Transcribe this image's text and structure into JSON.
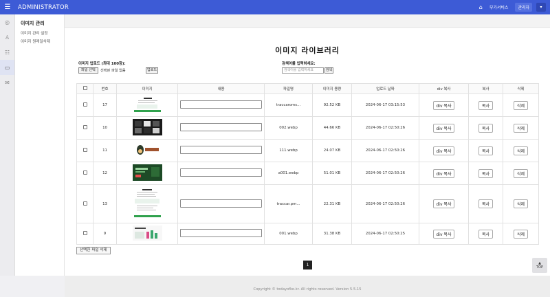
{
  "app": {
    "brand": "ADMINISTRATOR"
  },
  "topbar": {
    "service_label": "부가서비스",
    "admin_label": "관리자"
  },
  "subnav": {
    "heading": "이미지 관리",
    "items": [
      "이미지 관리 설정",
      "이미지 원래일삭제"
    ]
  },
  "page": {
    "title": "이미지 라이브러리",
    "upload_label": "이미지 업로드 (최대 100장):",
    "file_button": "파일 선택",
    "file_none": "선택된 파일 없음",
    "upload_button": "업로드",
    "search_label": "검색어를 입력하세요:",
    "search_placeholder": "검색어를 입력하세요",
    "search_button": "검색",
    "delete_selected": "선택한 파일 삭제",
    "current_page": "1",
    "top_button": "TOP",
    "footer": "Copyright © todayofko.kr. All rights reserved. Version 5.5.15"
  },
  "table": {
    "headers": [
      "번호",
      "이미지",
      "내용",
      "파일명",
      "이미지 용량",
      "업로드 날짜",
      "div 복사",
      "복사",
      "삭제"
    ],
    "div_copy_label": "div 복사",
    "copy_label": "복사",
    "delete_label": "삭제",
    "rows": [
      {
        "no": "17",
        "filename": "traccaroms...",
        "size": "92.52 KB",
        "date": "2024-06-17 03:15:53",
        "thumb": "web-page"
      },
      {
        "no": "10",
        "filename": "002.webp",
        "size": "44.66 KB",
        "date": "2024-06-17 02:50:26",
        "thumb": "dark-grid"
      },
      {
        "no": "11",
        "filename": "111.webp",
        "size": "24.07 KB",
        "date": "2024-06-17 02:50:26",
        "thumb": "profile-logo"
      },
      {
        "no": "12",
        "filename": "a001.webp",
        "size": "51.01 KB",
        "date": "2024-06-17 02:50:26",
        "thumb": "green-banner"
      },
      {
        "no": "13",
        "filename": "traccar.pm...",
        "size": "22.31 KB",
        "date": "2024-06-17 02:50:26",
        "thumb": "long-page"
      },
      {
        "no": "9",
        "filename": "001.webp",
        "size": "31.38 KB",
        "date": "2024-06-17 02:50:25",
        "thumb": "chart-card"
      }
    ]
  }
}
